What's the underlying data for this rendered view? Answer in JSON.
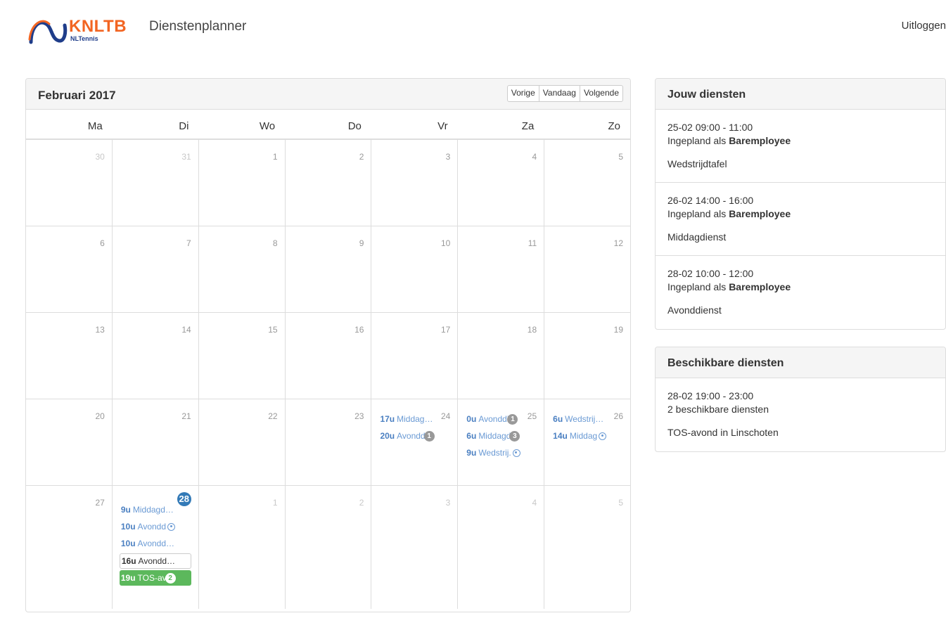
{
  "header": {
    "logo_word": "KNLTB",
    "logo_sub": "NLTennis",
    "app_title": "Dienstenplanner",
    "logout": "Uitloggen"
  },
  "calendar": {
    "title": "Februari 2017",
    "buttons": {
      "prev": "Vorige",
      "today": "Vandaag",
      "next": "Volgende"
    },
    "weekdays": [
      "Ma",
      "Di",
      "Wo",
      "Do",
      "Vr",
      "Za",
      "Zo"
    ],
    "weeks": [
      [
        "30",
        "31",
        "1",
        "2",
        "3",
        "4",
        "5"
      ],
      [
        "6",
        "7",
        "8",
        "9",
        "10",
        "11",
        "12"
      ],
      [
        "13",
        "14",
        "15",
        "16",
        "17",
        "18",
        "19"
      ],
      [
        "20",
        "21",
        "22",
        "23",
        "24",
        "25",
        "26"
      ],
      [
        "27",
        "28",
        "1",
        "2",
        "3",
        "4",
        "5"
      ]
    ],
    "events": {
      "fri24": [
        {
          "time": "17u",
          "text": "Middag…"
        },
        {
          "time": "20u",
          "text": "Avondd",
          "badge": "1"
        }
      ],
      "sat25": [
        {
          "time": "0u",
          "text": "Avonddi",
          "badge": "1"
        },
        {
          "time": "6u",
          "text": "Middagd",
          "badge": "3"
        },
        {
          "time": "9u",
          "text": "Wedstrij.",
          "icon": "target-icon"
        }
      ],
      "sun26": [
        {
          "time": "6u",
          "text": "Wedstrij…"
        },
        {
          "time": "14u",
          "text": "Middag",
          "icon": "target-icon"
        }
      ],
      "tue28": [
        {
          "time": "9u",
          "text": "Middagd…"
        },
        {
          "time": "10u",
          "text": "Avondd",
          "icon": "target-icon"
        },
        {
          "time": "10u",
          "text": "Avondd…"
        },
        {
          "time": "16u",
          "text": "Avondd…"
        },
        {
          "time": "19u",
          "text": "TOS-av",
          "badge": "2"
        }
      ]
    }
  },
  "my_shifts": {
    "title": "Jouw diensten",
    "items": [
      {
        "datetime": "25-02 09:00 - 11:00",
        "role_prefix": "Ingepland als ",
        "role": "Baremployee",
        "name": "Wedstrijdtafel"
      },
      {
        "datetime": "26-02 14:00 - 16:00",
        "role_prefix": "Ingepland als ",
        "role": "Baremployee",
        "name": "Middagdienst"
      },
      {
        "datetime": "28-02 10:00 - 12:00",
        "role_prefix": "Ingepland als ",
        "role": "Baremployee",
        "name": "Avonddienst"
      }
    ]
  },
  "available": {
    "title": "Beschikbare diensten",
    "items": [
      {
        "datetime": "28-02 19:00 - 23:00",
        "count": "2 beschikbare diensten",
        "name": "TOS-avond in Linschoten"
      }
    ]
  },
  "colors": {
    "accent": "#337ab7",
    "brand_orange": "#f26522",
    "success": "#5cb85c",
    "event_link": "#6a9ad4"
  }
}
